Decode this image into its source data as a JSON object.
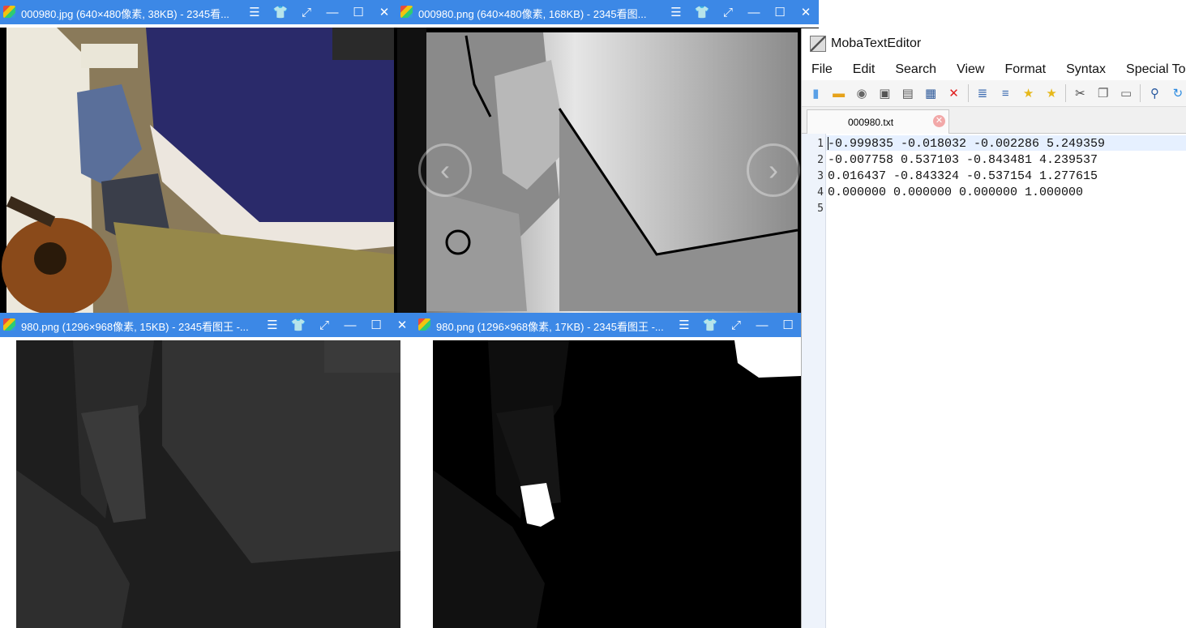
{
  "viewers": [
    {
      "title": "000980.jpg  (640×480像素, 38KB)  - 2345看..."
    },
    {
      "title": "000980.png  (640×480像素, 168KB)  - 2345看图..."
    },
    {
      "title": "980.png  (1296×968像素, 15KB)  - 2345看图王 -..."
    },
    {
      "title": "980.png  (1296×968像素, 17KB)  - 2345看图王 -..."
    }
  ],
  "viewer_buttons": {
    "menu": "☰",
    "skin": "👕",
    "fullscreen": "⤢",
    "minimize": "—",
    "maximize": "☐",
    "close": "✕"
  },
  "nav": {
    "prev": "‹",
    "next": "›"
  },
  "editor": {
    "app_title": "MobaTextEditor",
    "menu": [
      "File",
      "Edit",
      "Search",
      "View",
      "Format",
      "Syntax",
      "Special To"
    ],
    "tab_label": "000980.txt",
    "line_numbers": [
      "1",
      "2",
      "3",
      "4",
      "5"
    ],
    "lines": [
      "-0.999835 -0.018032 -0.002286 5.249359",
      "-0.007758 0.537103 -0.843481 4.239537",
      "0.016437 -0.843324 -0.537154 1.277615",
      "0.000000 0.000000 0.000000 1.000000",
      ""
    ]
  },
  "colors": {
    "titlebar": "#3c88e6",
    "current_line": "#e6f0ff"
  }
}
